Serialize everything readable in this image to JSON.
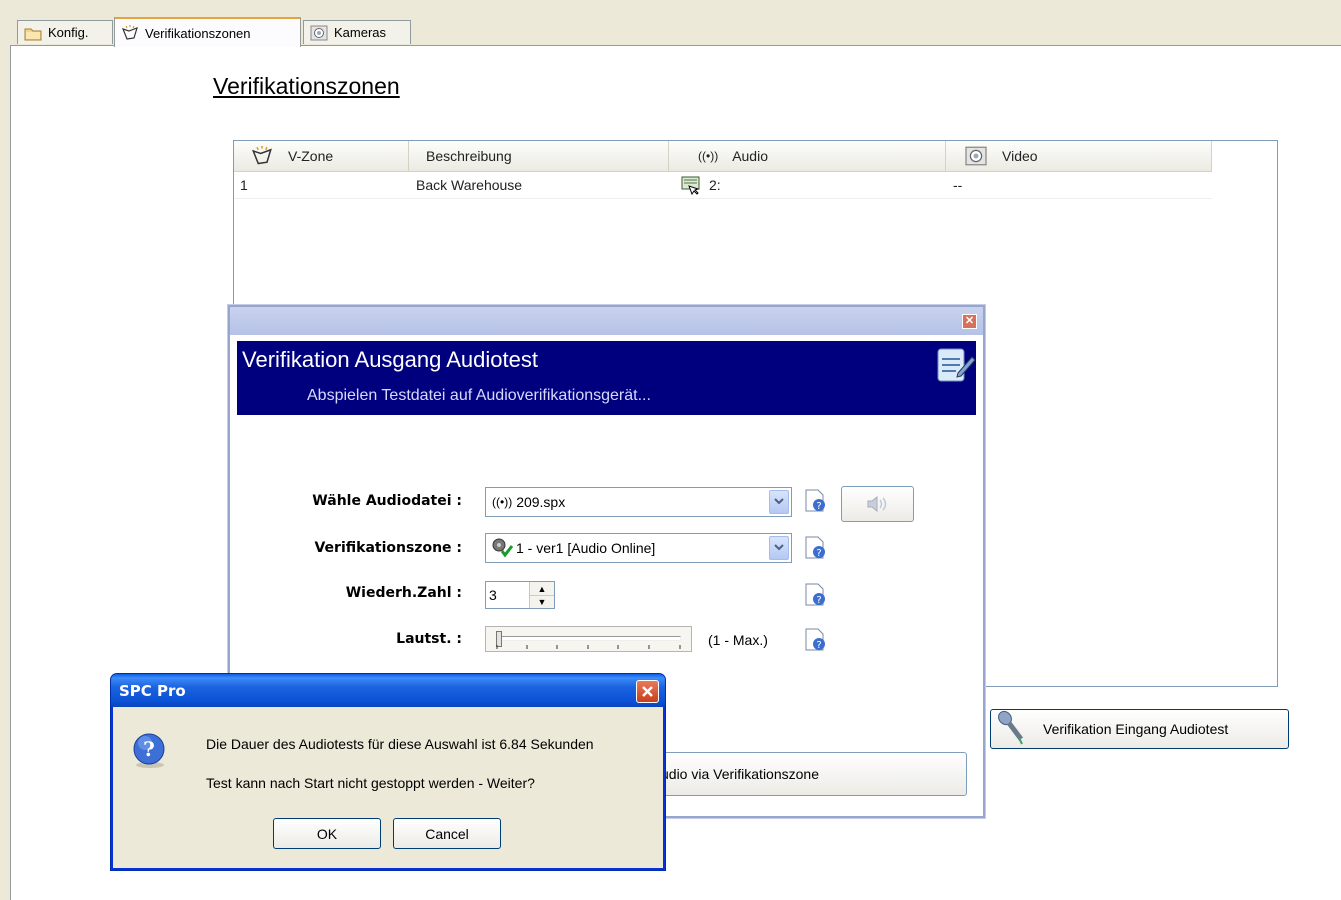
{
  "tabs": [
    {
      "label": "Konfig.",
      "icon": "folder-config-icon"
    },
    {
      "label": "Verifikationszonen",
      "icon": "verification-zone-icon",
      "active": true
    },
    {
      "label": "Kameras",
      "icon": "camera-icon"
    }
  ],
  "page_title": "Verifikationszonen",
  "grid": {
    "columns": [
      "V-Zone",
      "Beschreibung",
      "Audio",
      "Video"
    ],
    "rows": [
      {
        "zone": "1",
        "description": "Back Warehouse",
        "audio": "2:",
        "video": "--"
      }
    ]
  },
  "audio_test_dialog": {
    "title": "Verifikation Ausgang Audiotest",
    "subtitle": "Abspielen Testdatei auf Audioverifikationsgerät...",
    "fields": {
      "audio_file_label": "Wähle Audiodatei :",
      "audio_file_value": "209.spx",
      "zone_label": "Verifikationszone :",
      "zone_value": "1 - ver1 [Audio Online]",
      "repeat_label": "Wiederh.Zahl :",
      "repeat_value": "3",
      "volume_label": "Lautst. :",
      "volume_range": "(1 - Max.)",
      "volume_level": 0.0
    },
    "play_button_partial_label": "udio via Verifikationszone"
  },
  "input_test_button": "Verifikation Eingang Audiotest",
  "message_box": {
    "title": "SPC Pro",
    "line1": "Die Dauer des Audiotests für diese Auswahl ist 6.84 Sekunden",
    "line2": "Test kann nach Start nicht gestoppt werden - Weiter?",
    "ok": "OK",
    "cancel": "Cancel"
  },
  "colors": {
    "banner": "#00007f",
    "xp_title_blue": "#0a50d4",
    "tab_highlight": "#e6a23c"
  }
}
